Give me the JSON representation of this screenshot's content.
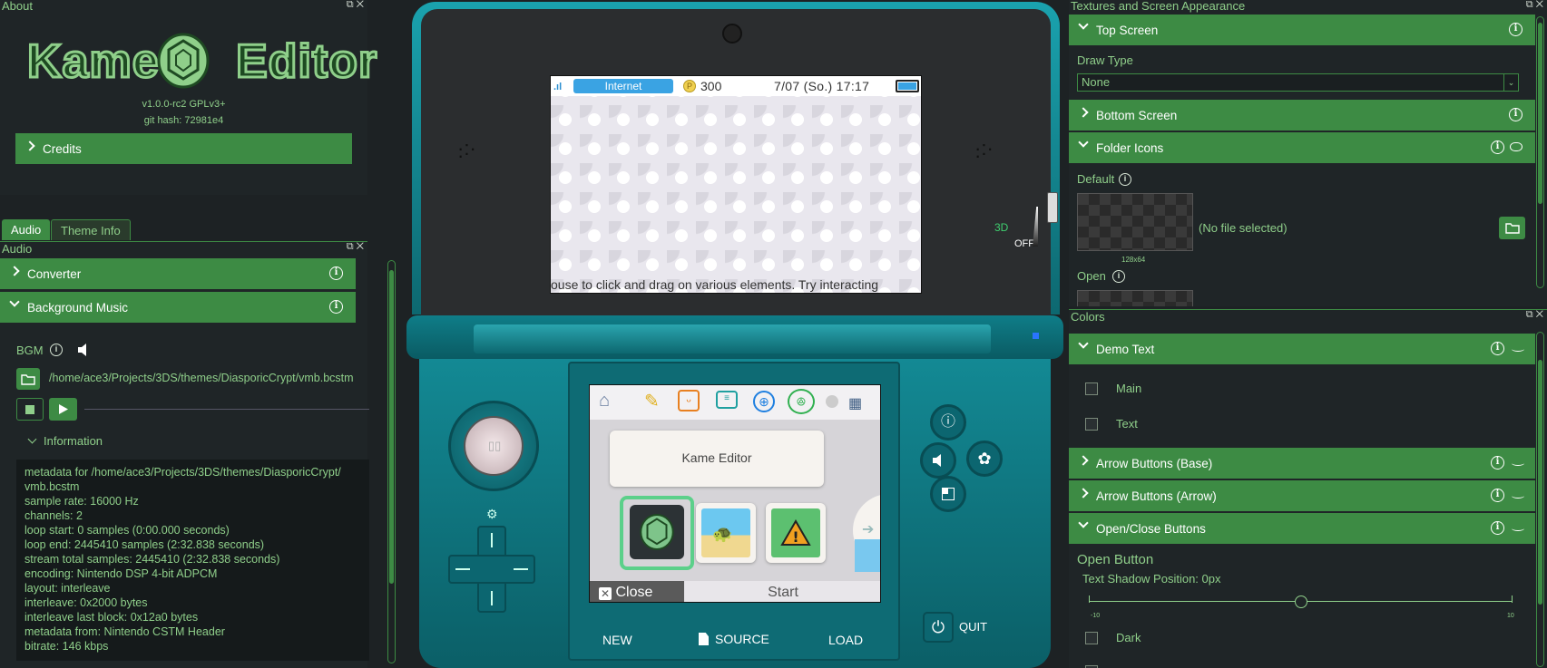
{
  "about": {
    "panel_title": "About",
    "logo_left": "Kame",
    "logo_right": "Editor",
    "version": "v1.0.0-rc2 GPLv3+",
    "git_hash": "git hash: 72981e4",
    "credits_label": "Credits"
  },
  "tabs": {
    "audio": "Audio",
    "theme_info": "Theme Info"
  },
  "audio": {
    "panel_title": "Audio",
    "converter_label": "Converter",
    "bgm_section_label": "Background Music",
    "bgm_label": "BGM",
    "bgm_path": "/home/ace3/Projects/3DS/themes/DiasporicCrypt/vmb.bcstm",
    "information_label": "Information",
    "metadata_lines": [
      "metadata for /home/ace3/Projects/3DS/themes/DiasporicCrypt/",
      "vmb.bcstm",
      "sample rate: 16000 Hz",
      "channels: 2",
      "loop start: 0 samples (0:00.000 seconds)",
      "loop end: 2445410 samples (2:32.838 seconds)",
      "stream total samples: 2445410 (2:32.838 seconds)",
      "encoding: Nintendo DSP 4-bit ADPCM",
      "layout: interleave",
      "interleave: 0x2000 bytes",
      "interleave last block: 0x12a0 bytes",
      "metadata from: Nintendo CSTM Header",
      "bitrate: 146 kbps"
    ]
  },
  "device": {
    "top_screen": {
      "connection": "Internet",
      "coins": "300",
      "datetime": "7/07 (So.) 17:17",
      "ticker": "ouse to click and drag on various elements.  Try interacting"
    },
    "slider_3d_label": "3D",
    "slider_3d_off": "OFF",
    "app_name": "Kame Editor",
    "close_label": "Close",
    "start_label": "Start",
    "bottom_buttons": {
      "new": "NEW",
      "source": "SOURCE",
      "load": "LOAD"
    },
    "quit_label": "QUIT"
  },
  "textures": {
    "panel_title": "Textures and Screen Appearance",
    "top_screen_label": "Top Screen",
    "draw_type_label": "Draw Type",
    "draw_type_value": "None",
    "bottom_screen_label": "Bottom Screen",
    "folder_icons_label": "Folder Icons",
    "default_label": "Default",
    "no_file_label": "(No file selected)",
    "size_label": "128x64",
    "open_label": "Open"
  },
  "colors": {
    "panel_title": "Colors",
    "demo_text_label": "Demo Text",
    "main_label": "Main",
    "text_label": "Text",
    "arrow_base_label": "Arrow Buttons (Base)",
    "arrow_arrow_label": "Arrow Buttons (Arrow)",
    "open_close_label": "Open/Close Buttons",
    "open_button_label": "Open Button",
    "shadow_label": "Text Shadow Position:  0px",
    "slider_min": "-10",
    "slider_max": "10",
    "slider_value": 0,
    "dark_label": "Dark"
  },
  "palette": {
    "accent": "#3d8b44",
    "text_green": "#8fcf8a",
    "background": "#1d2224",
    "device_teal": "#11707a"
  }
}
